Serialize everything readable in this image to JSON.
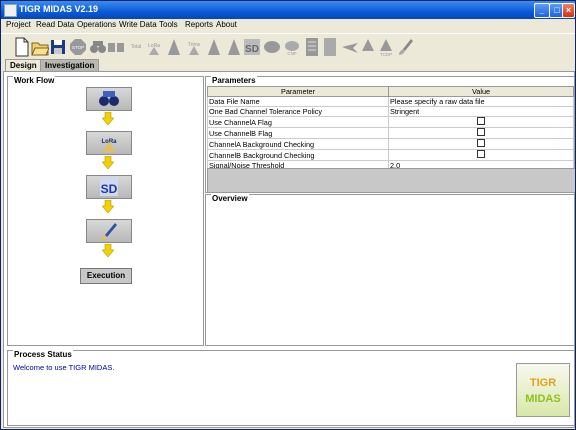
{
  "window": {
    "title": "TIGR MIDAS V2.19"
  },
  "menu": [
    "Project",
    "Read Data",
    "Operations",
    "Write Data",
    "Tools",
    "Reports",
    "About"
  ],
  "toolbar": {
    "icon_names": [
      "new-file-icon",
      "open-folder-icon",
      "save-disk-icon",
      "stop-icon",
      "binoculars-icon",
      "split-icon",
      "total-lowess-icon",
      "lowess-icon",
      "flip-icon",
      "normalize-icon",
      "sd-icon",
      "kernel-icon",
      "filter-icon",
      "document-icon",
      "plane-icon",
      "rmm-icon",
      "slice-icon",
      "brush-icon"
    ],
    "small_labels": {
      "stop": "STOP",
      "total": "Total",
      "lowess": "LoRa",
      "flip": "Trims",
      "kernel": "Kbn",
      "cnf": "CNF",
      "tcdp": "TCDP"
    }
  },
  "tabs": [
    "Design",
    "Investigation"
  ],
  "workflow": {
    "title": "Work Flow",
    "execute_label": "Execution"
  },
  "parameters": {
    "title": "Parameters",
    "headers": [
      "Parameter",
      "Value"
    ],
    "rows": [
      {
        "name": "Data File Name",
        "value": "Please specify a raw data file"
      },
      {
        "name": "One Bad Channel Tolerance Policy",
        "value": "Stringent"
      },
      {
        "name": "Use ChannelA Flag",
        "value": ""
      },
      {
        "name": "Use ChannelB Flag",
        "value": ""
      },
      {
        "name": "ChannelA Background Checking",
        "value": ""
      },
      {
        "name": "ChannelB Background Checking",
        "value": ""
      },
      {
        "name": "Signal/Noise Threshold",
        "value": "2.0"
      }
    ]
  },
  "overview": {
    "title": "Overview"
  },
  "process_status": {
    "title": "Process Status",
    "message": "Welcome to use TIGR MIDAS.",
    "logo_text": "TIGR MIDAS"
  },
  "colors": {
    "titlebar": "#0a5ad8",
    "arrow": "#f5d000",
    "status_text": "#0000a0"
  }
}
